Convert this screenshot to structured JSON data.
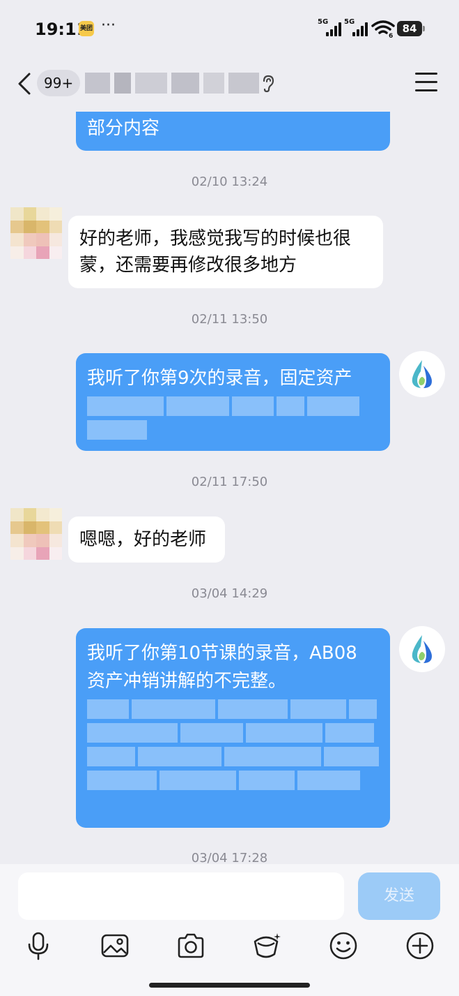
{
  "status_bar": {
    "time": "19:11",
    "app_badge": "美团",
    "more": "···",
    "signal_1_label": "5G",
    "signal_2_label": "5G",
    "wifi_label": "6",
    "battery": "84"
  },
  "nav": {
    "unread_count": "99+",
    "icons": [
      "back-arrow-icon",
      "ear-icon",
      "menu-icon"
    ]
  },
  "messages": [
    {
      "type": "mine",
      "text": "部分内容"
    },
    {
      "type": "timestamp",
      "text": "02/10 13:24"
    },
    {
      "type": "other",
      "line1": "好的老师，我感觉我写的时候也很",
      "line2": "蒙，还需要再修改很多地方"
    },
    {
      "type": "timestamp",
      "text": "02/11 13:50"
    },
    {
      "type": "mine",
      "text": "我听了你第9次的录音，固定资产"
    },
    {
      "type": "timestamp",
      "text": "02/11 17:50"
    },
    {
      "type": "other",
      "text": "嗯嗯，好的老师"
    },
    {
      "type": "timestamp",
      "text": "03/04 14:29"
    },
    {
      "type": "mine",
      "line1": "我听了你第10节课的录音，AB08",
      "line2": "资产冲销讲解的不完整。"
    },
    {
      "type": "timestamp",
      "text": "03/04 17:28"
    }
  ],
  "input": {
    "placeholder": "",
    "send_label": "发送"
  },
  "toolbar": [
    "microphone-icon",
    "image-icon",
    "camera-icon",
    "red-packet-icon",
    "emoji-icon",
    "plus-icon"
  ],
  "colors": {
    "background": "#ededf2",
    "mine_bubble": "#4a9ef7",
    "other_bubble": "#ffffff",
    "send_button": "#9ccbf7"
  }
}
